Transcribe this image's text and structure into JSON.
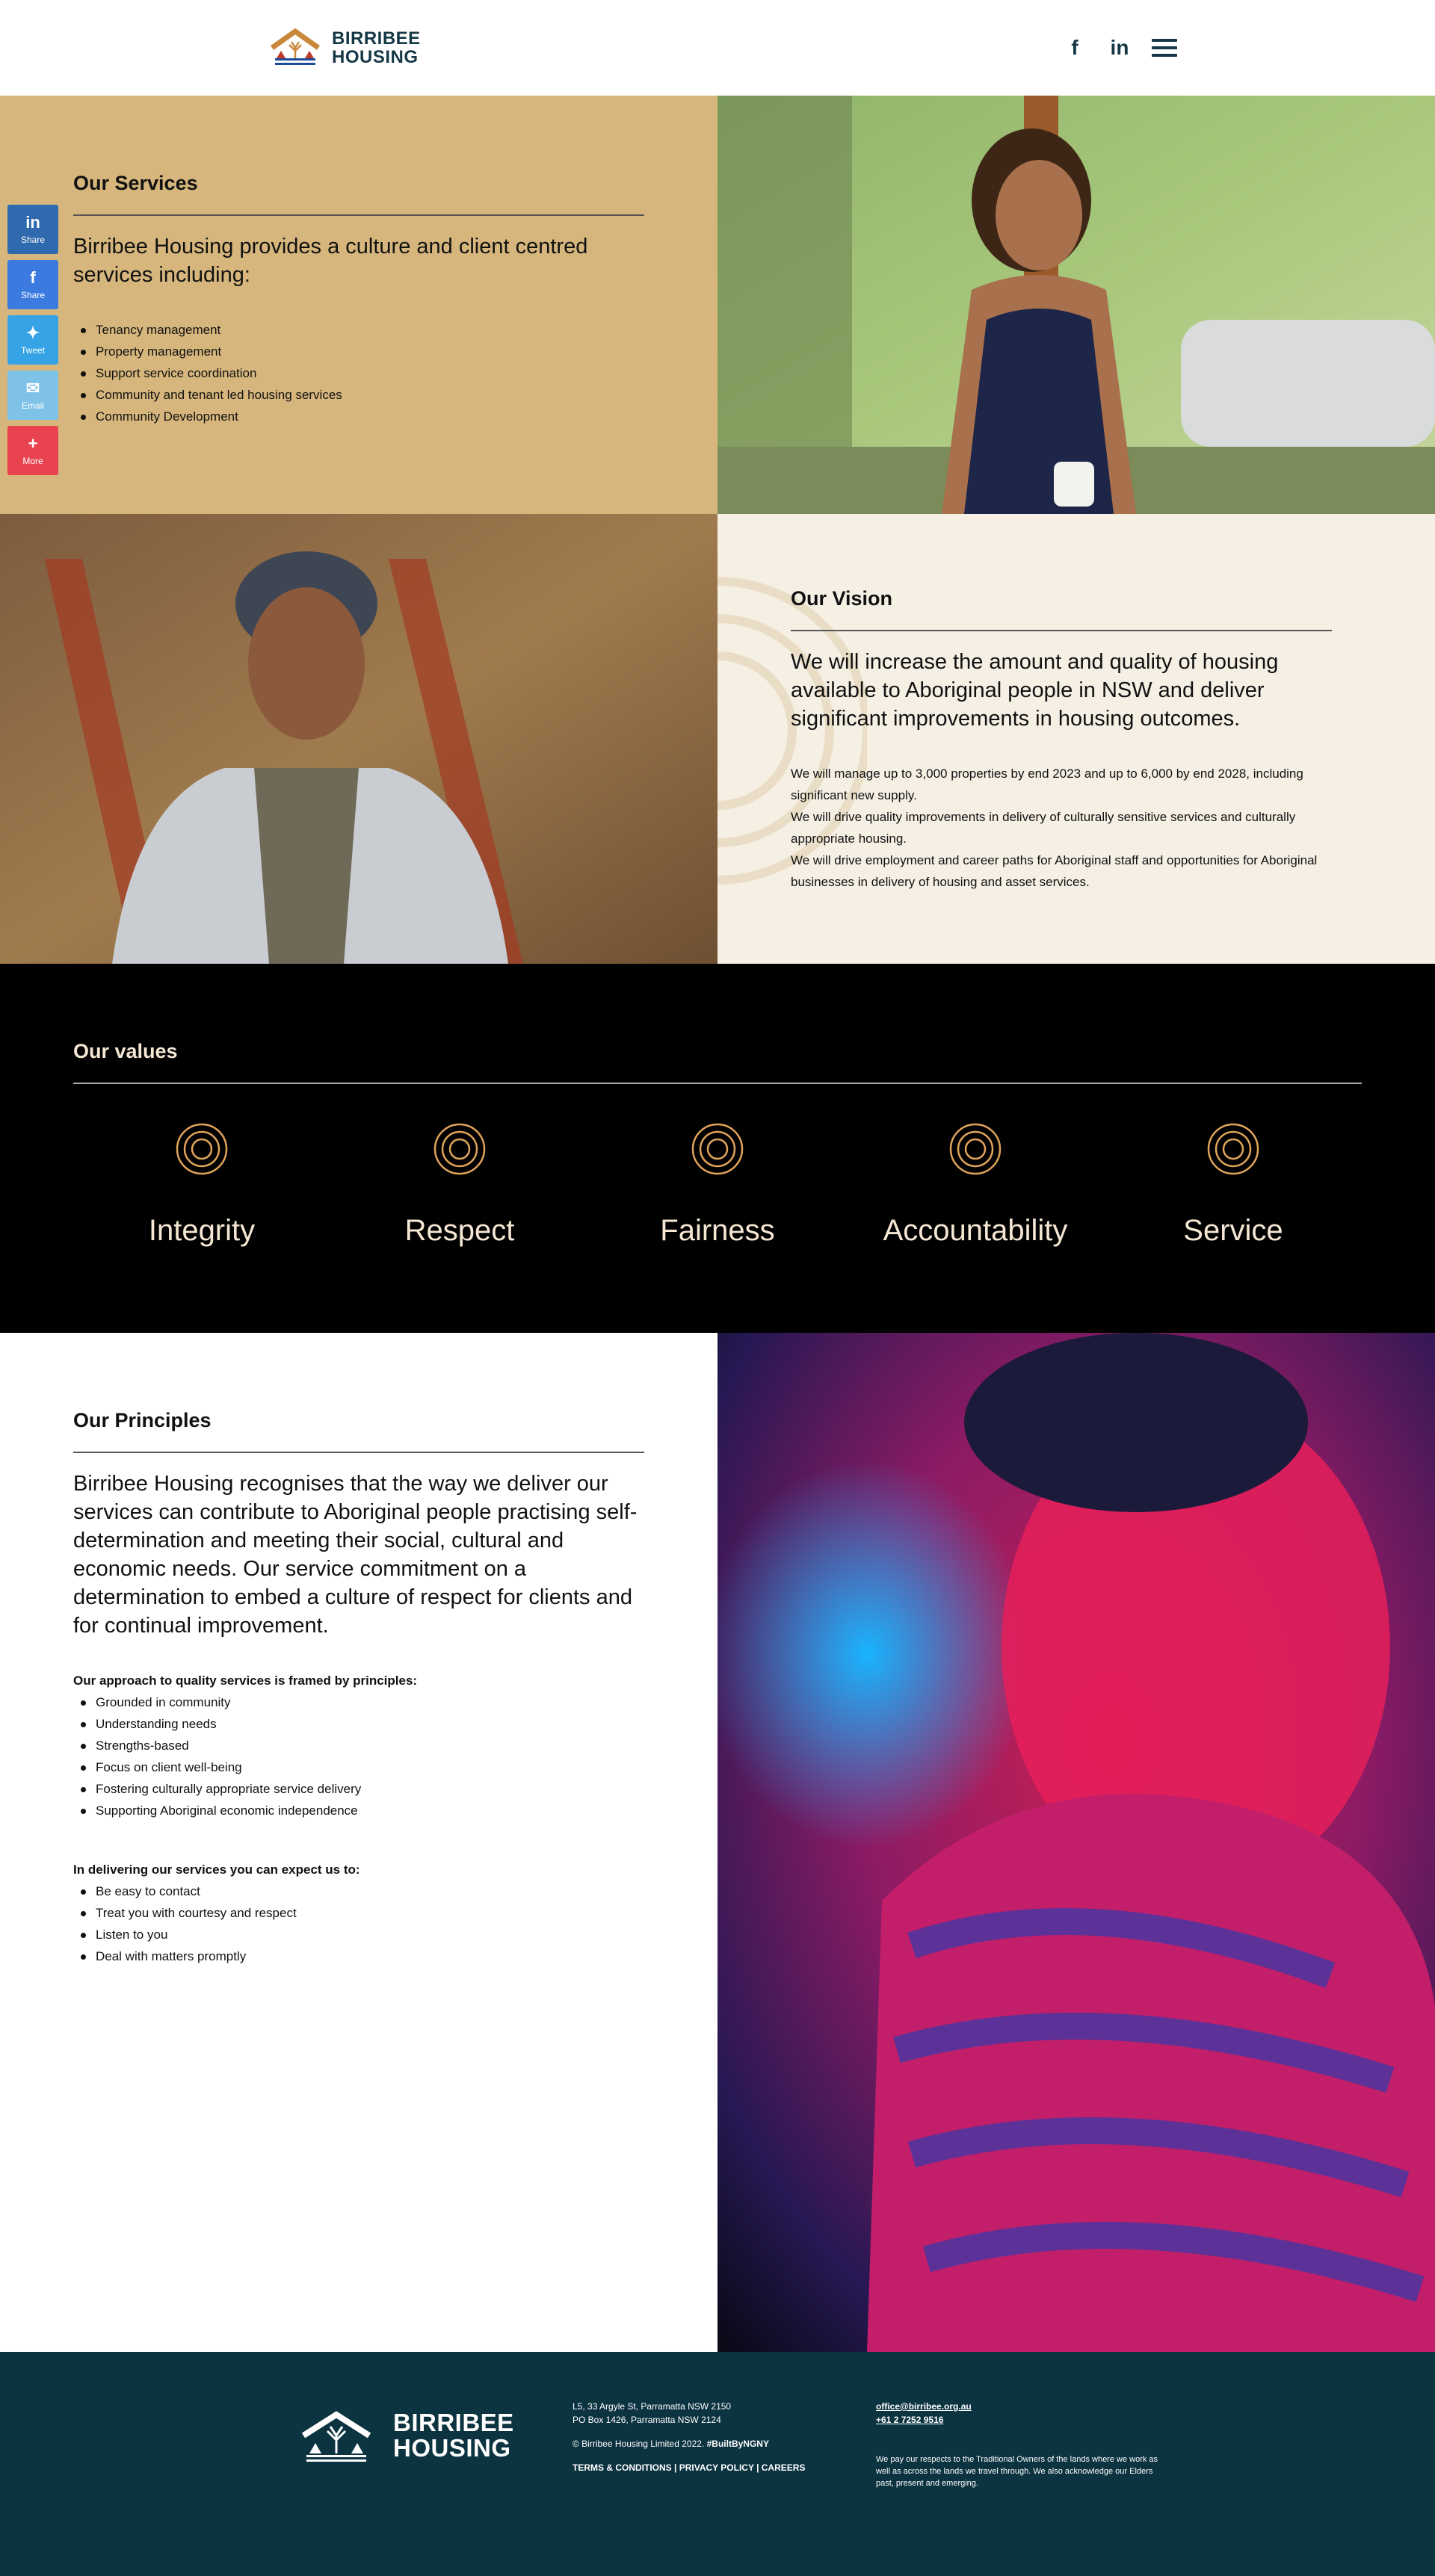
{
  "header": {
    "brand_line1": "BIRRIBEE",
    "brand_line2": "HOUSING",
    "facebook_glyph": "f",
    "linkedin_glyph": "in"
  },
  "share": [
    {
      "name": "linkedin-share-button",
      "glyph": "in",
      "label": "Share",
      "color": "#2e6aad"
    },
    {
      "name": "facebook-share-button",
      "glyph": "f",
      "label": "Share",
      "color": "#3b7be0"
    },
    {
      "name": "twitter-share-button",
      "glyph": "✦",
      "label": "Tweet",
      "color": "#35a3e6"
    },
    {
      "name": "email-share-button",
      "glyph": "✉",
      "label": "Email",
      "color": "#7fc2e8"
    },
    {
      "name": "more-share-button",
      "glyph": "+",
      "label": "More",
      "color": "#e9434f"
    }
  ],
  "services": {
    "title": "Our Services",
    "lead": "Birribee Housing  provides a culture and client centred services including:",
    "items": [
      "Tenancy management",
      "Property management",
      "Support service coordination",
      "Community and tenant led housing services",
      "Community Development"
    ]
  },
  "vision": {
    "title": "Our Vision",
    "lead": "We will increase the amount and quality of housing available to Aboriginal people in NSW and deliver significant improvements in housing outcomes.",
    "p1": "We will manage up to 3,000 properties by end 2023 and up to 6,000 by end 2028, including significant new supply.",
    "p2": "We will drive quality improvements in delivery of culturally sensitive services and culturally appropriate housing.",
    "p3": "We will drive employment and career paths for Aboriginal staff and opportunities for Aboriginal businesses in delivery of housing and asset services."
  },
  "values": {
    "title": "Our values",
    "items": [
      "Integrity",
      "Respect",
      "Fairness",
      "Accountability",
      "Service"
    ]
  },
  "principles": {
    "title": "Our Principles",
    "lead": "Birribee Housing recognises that the way we deliver our services can contribute to Aboriginal people practising self-determination and meeting their social, cultural and economic needs. Our service commitment on a determination to embed a culture of respect for clients and for continual improvement.",
    "approach_head": "Our approach to quality services is framed by principles:",
    "approach": [
      "Grounded in community",
      "Understanding needs",
      "Strengths-based",
      "Focus on client well-being",
      "Fostering culturally appropriate service delivery",
      "Supporting Aboriginal economic independence"
    ],
    "expect_head": "In delivering our services you can expect us to:",
    "expect": [
      "Be easy to contact",
      "Treat you with courtesy and respect",
      "Listen to you",
      "Deal with matters promptly"
    ]
  },
  "footer": {
    "brand_line1": "BIRRIBEE",
    "brand_line2": "HOUSING",
    "address1": "L5, 33 Argyle St, Parramatta NSW 2150",
    "address2": "PO Box 1426, Parramatta NSW 2124",
    "copyright": "© Birribee Housing Limited 2022.",
    "hashtag": "#BuiltByNGNY",
    "terms": "TERMS & CONDITIONS",
    "privacy": "PRIVACY POLICY",
    "careers": "CAREERS",
    "email": "office@birribee.org.au",
    "phone": "+61 2 7252 9516",
    "acknowledgement": "We pay our respects to the Traditional Owners of the lands where we work as well as across the lands we travel through. We also acknowledge our Elders past, present and emerging."
  },
  "colors": {
    "services_bg": "#d6b67c",
    "vision_bg": "#f5efe4",
    "values_bg": "#000000",
    "values_accent": "#e0a35a",
    "footer_bg": "#0b3340"
  }
}
